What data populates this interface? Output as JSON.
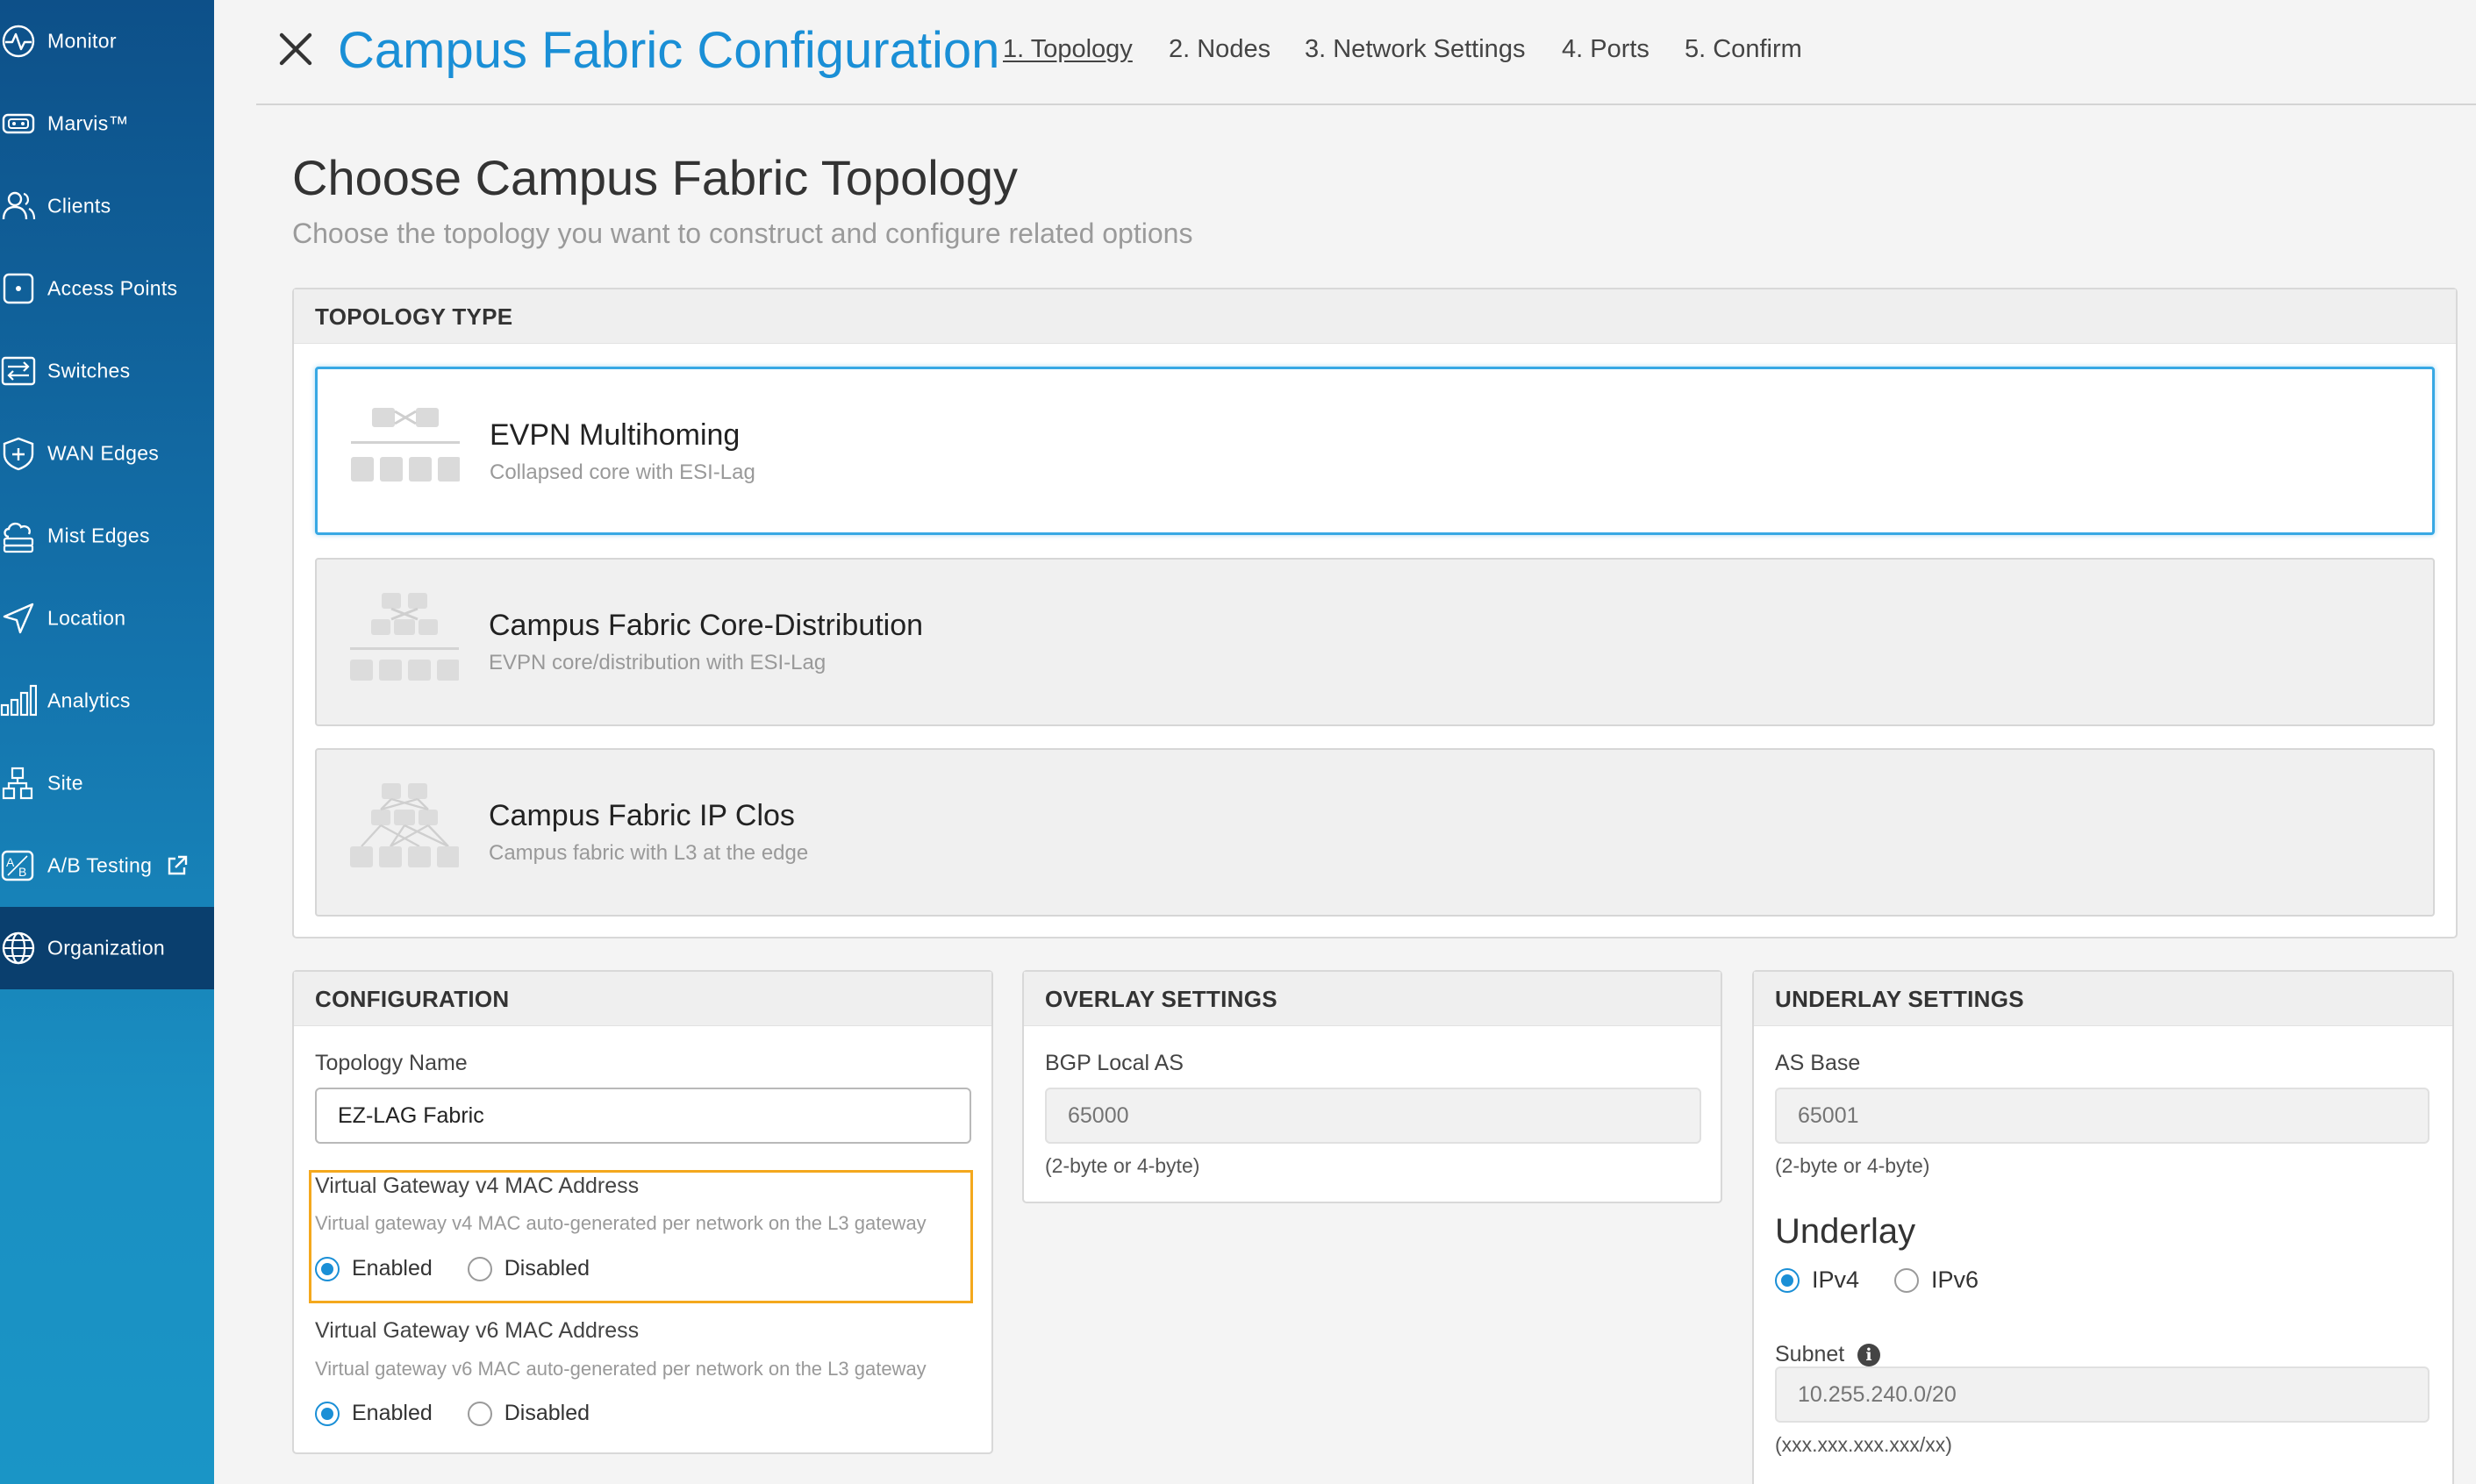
{
  "sidebar": {
    "items": [
      {
        "label": "Monitor",
        "icon": "monitor-icon"
      },
      {
        "label": "Marvis™",
        "icon": "marvis-icon"
      },
      {
        "label": "Clients",
        "icon": "clients-icon"
      },
      {
        "label": "Access Points",
        "icon": "access-point-icon"
      },
      {
        "label": "Switches",
        "icon": "switch-icon"
      },
      {
        "label": "WAN Edges",
        "icon": "wan-edge-icon"
      },
      {
        "label": "Mist Edges",
        "icon": "mist-edge-icon"
      },
      {
        "label": "Location",
        "icon": "location-icon"
      },
      {
        "label": "Analytics",
        "icon": "analytics-icon"
      },
      {
        "label": "Site",
        "icon": "site-icon"
      },
      {
        "label": "A/B Testing",
        "icon": "ab-testing-icon"
      },
      {
        "label": "Organization",
        "icon": "organization-icon",
        "active": true
      }
    ]
  },
  "header": {
    "title": "Campus Fabric Configuration",
    "steps": [
      "1. Topology",
      "2. Nodes",
      "3. Network Settings",
      "4. Ports",
      "5. Confirm"
    ],
    "current_step": 0
  },
  "page": {
    "heading": "Choose Campus Fabric Topology",
    "subheading": "Choose the topology you want to construct and configure related options"
  },
  "topology": {
    "header": "TOPOLOGY TYPE",
    "options": [
      {
        "name": "EVPN Multihoming",
        "desc": "Collapsed core with ESI-Lag",
        "selected": true
      },
      {
        "name": "Campus Fabric Core-Distribution",
        "desc": "EVPN core/distribution with ESI-Lag",
        "selected": false
      },
      {
        "name": "Campus Fabric IP Clos",
        "desc": "Campus fabric with L3 at the edge",
        "selected": false
      }
    ]
  },
  "configuration": {
    "header": "CONFIGURATION",
    "topology_name_label": "Topology Name",
    "topology_name_value": "EZ-LAG Fabric",
    "v4_label": "Virtual Gateway v4 MAC Address",
    "v4_hint": "Virtual gateway v4 MAC auto-generated per network on the L3 gateway",
    "v6_label": "Virtual Gateway v6 MAC Address",
    "v6_hint": "Virtual gateway v6 MAC auto-generated per network on the L3 gateway",
    "enabled": "Enabled",
    "disabled": "Disabled",
    "v4_selected": "Enabled",
    "v6_selected": "Enabled"
  },
  "overlay": {
    "header": "OVERLAY SETTINGS",
    "bgp_label": "BGP Local AS",
    "bgp_placeholder": "65000",
    "bgp_hint": "(2-byte or 4-byte)"
  },
  "underlay": {
    "header": "UNDERLAY SETTINGS",
    "as_base_label": "AS Base",
    "as_base_placeholder": "65001",
    "as_base_hint": "(2-byte or 4-byte)",
    "section_title": "Underlay",
    "ipv4": "IPv4",
    "ipv6": "IPv6",
    "selected": "IPv4",
    "subnet_label": "Subnet",
    "subnet_placeholder": "10.255.240.0/20",
    "subnet_hint": "(xxx.xxx.xxx.xxx/xx)"
  },
  "colors": {
    "accent": "#1a8fd6",
    "highlight": "#f4a81d",
    "sidebar_active": "#0a3f6e"
  }
}
